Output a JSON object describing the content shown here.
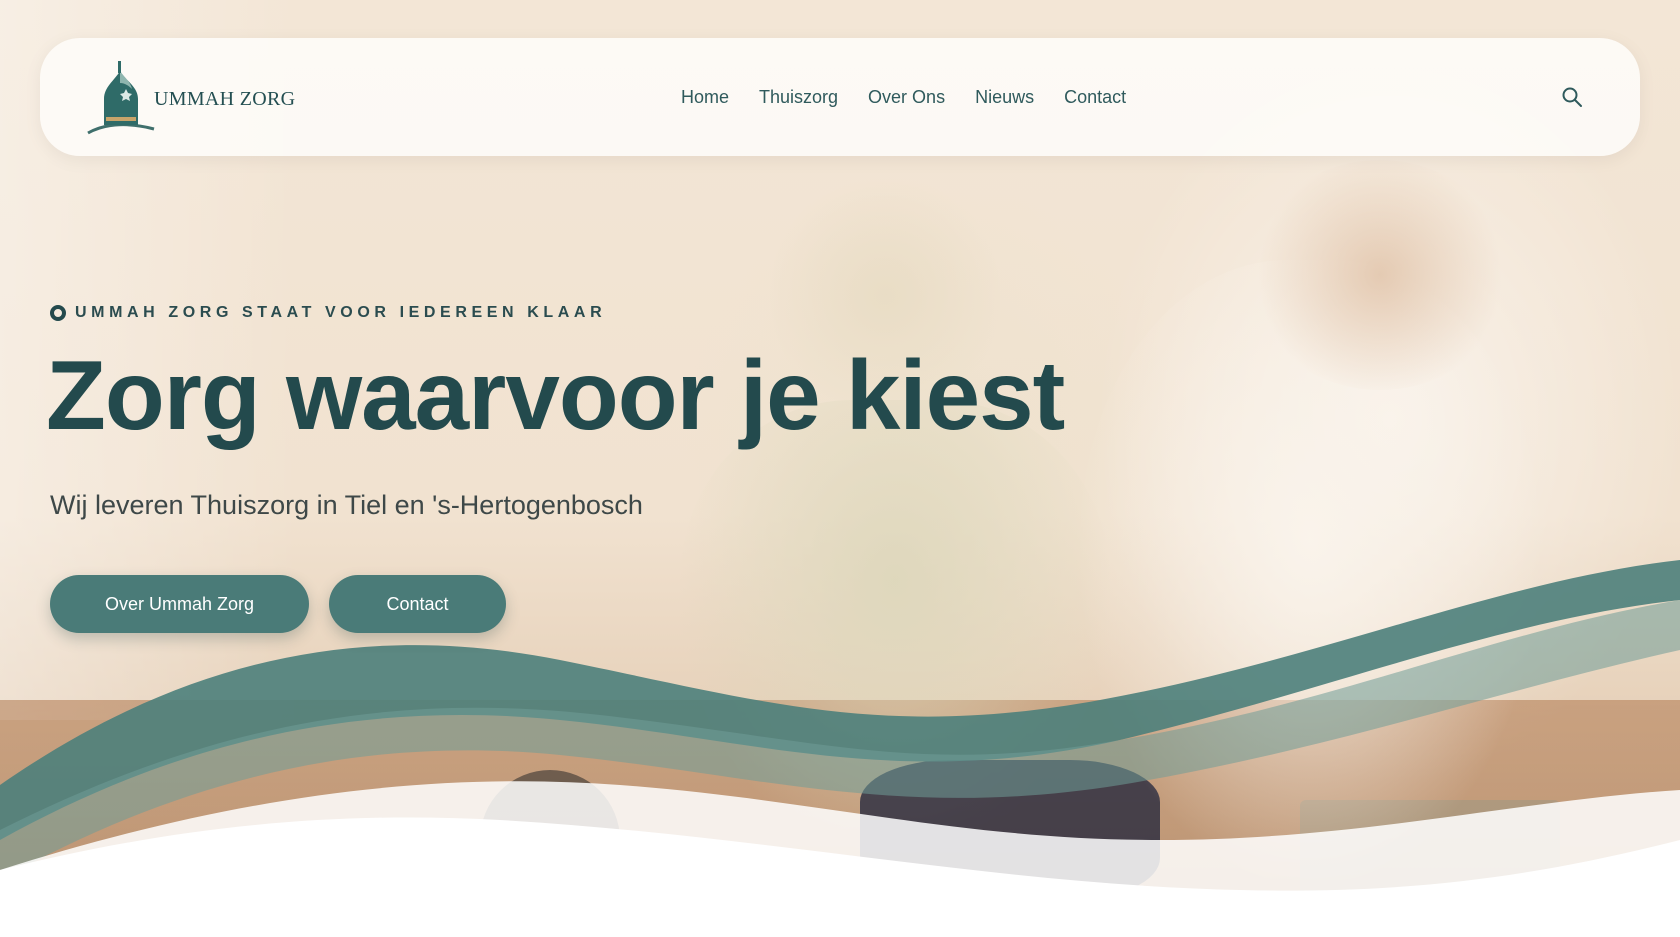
{
  "brand": {
    "name": "UMMAH ZORG",
    "primary_color": "#234a4d",
    "accent_color": "#4a7b78"
  },
  "nav": {
    "items": [
      {
        "label": "Home"
      },
      {
        "label": "Thuiszorg"
      },
      {
        "label": "Over Ons"
      },
      {
        "label": "Nieuws"
      },
      {
        "label": "Contact"
      }
    ],
    "search_icon": "search-icon"
  },
  "hero": {
    "eyebrow": "UMMAH ZORG STAAT VOOR IEDEREEN KLAAR",
    "headline": "Zorg waarvoor je kiest",
    "subtitle": "Wij leveren Thuiszorg in Tiel en 's-Hertogenbosch",
    "buttons": {
      "about": "Over Ummah Zorg",
      "contact": "Contact"
    }
  }
}
